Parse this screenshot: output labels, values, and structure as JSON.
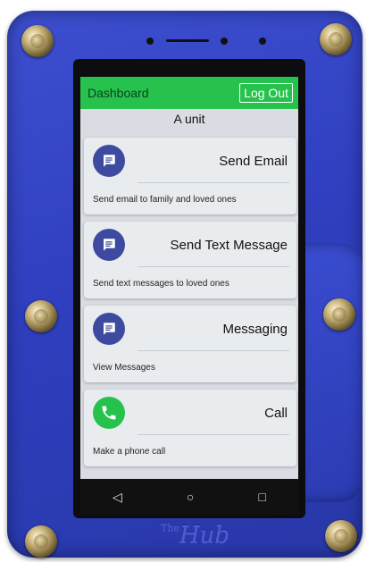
{
  "header": {
    "title": "Dashboard",
    "logout_label": "Log Out"
  },
  "unit_label": "A unit",
  "cards": [
    {
      "label": "Send Email",
      "description": "Send email to family and loved ones",
      "icon": "message-icon"
    },
    {
      "label": "Send Text Message",
      "description": "Send text messages to loved ones",
      "icon": "message-icon"
    },
    {
      "label": "Messaging",
      "description": "View Messages",
      "icon": "message-icon"
    },
    {
      "label": "Call",
      "description": "Make a phone call",
      "icon": "phone-icon"
    }
  ],
  "navbar": {
    "back_glyph": "◁",
    "home_glyph": "○",
    "recents_glyph": "□"
  },
  "case_brand": {
    "prefix": "The",
    "name": "Hub"
  },
  "colors": {
    "topbar": "#27c24d",
    "icon_blue": "#3d4aa0",
    "case_blue": "#2f3fbf"
  }
}
